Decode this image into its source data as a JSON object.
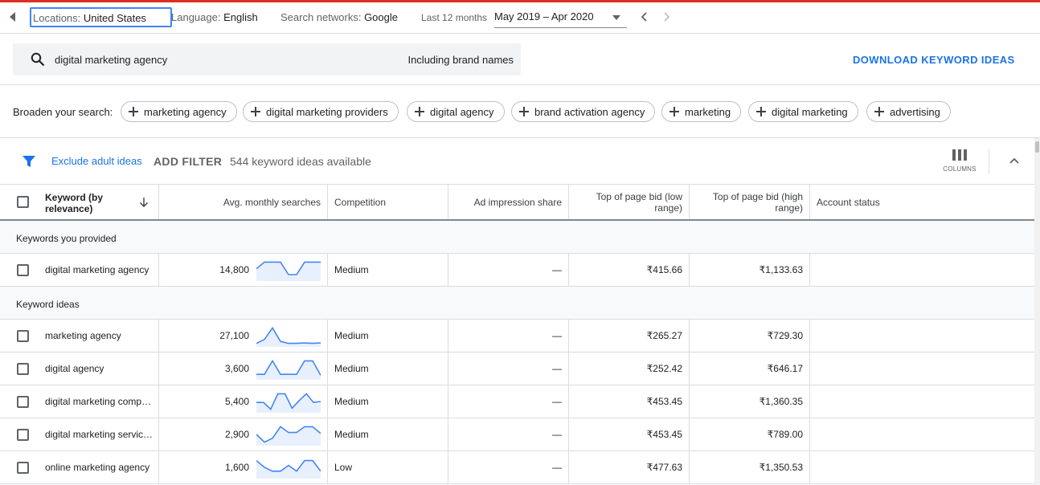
{
  "filters": {
    "locations_label": "Locations:",
    "locations_value": "United States",
    "language_label": "Language:",
    "language_value": "English",
    "networks_label": "Search networks:",
    "networks_value": "Google",
    "period_label": "Last 12 months",
    "date_range": "May 2019 – Apr 2020"
  },
  "search": {
    "query": "digital marketing agency",
    "brand_toggle": "Including brand names",
    "download_label": "DOWNLOAD KEYWORD IDEAS"
  },
  "broaden": {
    "label": "Broaden your search:",
    "chips": [
      "marketing agency",
      "digital marketing providers",
      "digital agency",
      "brand activation agency",
      "marketing",
      "digital marketing",
      "advertising"
    ]
  },
  "toolbar": {
    "exclude_label": "Exclude adult ideas",
    "add_filter": "ADD FILTER",
    "count_text": "544 keyword ideas available",
    "columns_label": "COLUMNS"
  },
  "table": {
    "headers": {
      "keyword": "Keyword (by relevance)",
      "searches": "Avg. monthly searches",
      "competition": "Competition",
      "impression": "Ad impression share",
      "bid_low": "Top of page bid (low range)",
      "bid_high": "Top of page bid (high range)",
      "status": "Account status"
    },
    "section_provided": "Keywords you provided",
    "section_ideas": "Keyword ideas",
    "provided": [
      {
        "keyword": "digital marketing agency",
        "searches": "14,800",
        "competition": "Medium",
        "impression": "—",
        "bid_low": "₹415.66",
        "bid_high": "₹1,133.63",
        "trend": [
          0.55,
          0.9,
          0.9,
          0.9,
          0.25,
          0.25,
          0.9,
          0.9,
          0.9
        ]
      }
    ],
    "ideas": [
      {
        "keyword": "marketing agency",
        "searches": "27,100",
        "competition": "Medium",
        "impression": "—",
        "bid_low": "₹265.27",
        "bid_high": "₹729.30",
        "trend": [
          0.1,
          0.3,
          0.9,
          0.2,
          0.1,
          0.1,
          0.12,
          0.1,
          0.12
        ]
      },
      {
        "keyword": "digital agency",
        "searches": "3,600",
        "competition": "Medium",
        "impression": "—",
        "bid_low": "₹252.42",
        "bid_high": "₹646.17",
        "trend": [
          0.2,
          0.2,
          0.9,
          0.2,
          0.2,
          0.2,
          0.9,
          0.9,
          0.15
        ]
      },
      {
        "keyword": "digital marketing comp…",
        "searches": "5,400",
        "competition": "Medium",
        "impression": "—",
        "bid_low": "₹453.45",
        "bid_high": "₹1,360.35",
        "trend": [
          0.45,
          0.45,
          0.1,
          0.9,
          0.9,
          0.15,
          0.55,
          0.9,
          0.45,
          0.5
        ]
      },
      {
        "keyword": "digital marketing servic…",
        "searches": "2,900",
        "competition": "Medium",
        "impression": "—",
        "bid_low": "₹453.45",
        "bid_high": "₹789.00",
        "trend": [
          0.5,
          0.1,
          0.3,
          0.9,
          0.6,
          0.6,
          0.9,
          0.9,
          0.55
        ]
      },
      {
        "keyword": "online marketing agency",
        "searches": "1,600",
        "competition": "Low",
        "impression": "—",
        "bid_low": "₹477.63",
        "bid_high": "₹1,350.53",
        "trend": [
          0.85,
          0.5,
          0.3,
          0.3,
          0.6,
          0.3,
          0.85,
          0.85,
          0.3
        ]
      }
    ]
  }
}
